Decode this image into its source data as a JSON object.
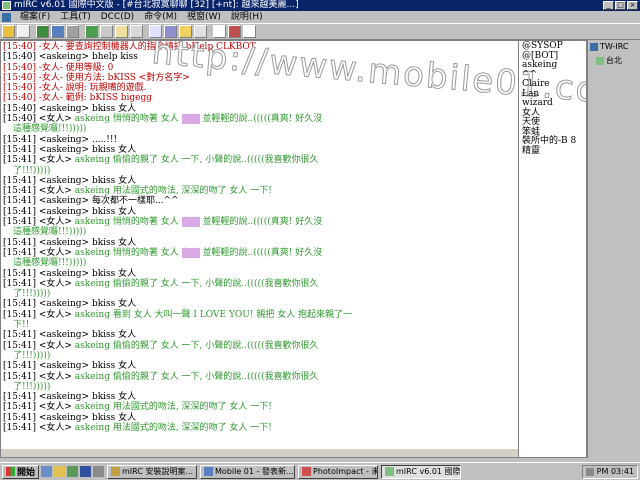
{
  "titlebar": {
    "title": "mIRC v6.01 國際中文版 - [#台北寂寞聊聊 [32] [+nt]: 越來越美麗...]"
  },
  "menubar": {
    "items": [
      "檔案(F)",
      "工具(T)",
      "DCC(D)",
      "命令(M)",
      "視窗(W)",
      "說明(H)"
    ]
  },
  "watermark": "http://www.mobile01.com",
  "chat": {
    "lines": [
      {
        "parts": [
          {
            "t": "[15:40] -女人- 要查詢控制機器人的指令請打 bHelp CLKBOT",
            "c": "red"
          }
        ]
      },
      {
        "parts": [
          {
            "t": "[15:40] <askeing> bhelp kiss"
          }
        ]
      },
      {
        "parts": [
          {
            "t": "[15:40] -女人- 使用等級: 0",
            "c": "red"
          }
        ]
      },
      {
        "parts": [
          {
            "t": "[15:40] -女人- 使用方法: bKISS <對方名字>",
            "c": "red"
          }
        ]
      },
      {
        "parts": [
          {
            "t": "[15:40] -女人- 說明: 玩親嘴的遊戲.",
            "c": "red"
          }
        ]
      },
      {
        "parts": [
          {
            "t": "[15:40] -女人- 範例: bKISS bigegg",
            "c": "red"
          }
        ]
      },
      {
        "parts": [
          {
            "t": "[15:40] <askeing> bkiss 女人"
          }
        ]
      },
      {
        "parts": [
          {
            "t": "[15:40] <女人> "
          },
          {
            "t": "askeing 悄悄的吻著 女人 ",
            "c": "green"
          },
          {
            "t": "女人",
            "c": "hl"
          },
          {
            "t": " 並輕輕的說..(((((真爽! 好久沒",
            "c": "green"
          }
        ]
      },
      {
        "indent": true,
        "parts": [
          {
            "t": "這種感覺囉!!!)))))",
            "c": "green"
          }
        ]
      },
      {
        "parts": [
          {
            "t": "[15:41] <askeing> .....!!!"
          }
        ]
      },
      {
        "parts": [
          {
            "t": "[15:41] <askeing> bkiss 女人"
          }
        ]
      },
      {
        "parts": [
          {
            "t": "[15:41] <女人> "
          },
          {
            "t": "askeing 偷偷的親了 女人 一下, 小聲的說..(((((我喜歡你很久",
            "c": "green"
          }
        ]
      },
      {
        "indent": true,
        "parts": [
          {
            "t": "了!!!)))))",
            "c": "green"
          }
        ]
      },
      {
        "parts": [
          {
            "t": "[15:41] <askeing> bkiss 女人"
          }
        ]
      },
      {
        "parts": [
          {
            "t": "[15:41] <女人> "
          },
          {
            "t": "askeing 用法國式的吻法, 深深的吻了 女人 一下!",
            "c": "green"
          }
        ]
      },
      {
        "parts": [
          {
            "t": "[15:41] <askeing> 每次都不一樣耶...^^"
          }
        ]
      },
      {
        "parts": [
          {
            "t": "[15:41] <askeing> bkiss 女人"
          }
        ]
      },
      {
        "parts": [
          {
            "t": "[15:41] <女人> "
          },
          {
            "t": "askeing 悄悄的吻著 女人 ",
            "c": "green"
          },
          {
            "t": "女人",
            "c": "hl"
          },
          {
            "t": " 並輕輕的說..(((((真爽! 好久沒",
            "c": "green"
          }
        ]
      },
      {
        "indent": true,
        "parts": [
          {
            "t": "這種感覺囉!!!)))))",
            "c": "green"
          }
        ]
      },
      {
        "parts": [
          {
            "t": "[15:41] <askeing> bkiss 女人"
          }
        ]
      },
      {
        "parts": [
          {
            "t": "[15:41] <女人> "
          },
          {
            "t": "askeing 悄悄的吻著 女人 ",
            "c": "green"
          },
          {
            "t": "女人",
            "c": "hl"
          },
          {
            "t": " 並輕輕的說..(((((真爽! 好久沒",
            "c": "green"
          }
        ]
      },
      {
        "indent": true,
        "parts": [
          {
            "t": "這種感覺囉!!!)))))",
            "c": "green"
          }
        ]
      },
      {
        "parts": [
          {
            "t": "[15:41] <askeing> bkiss 女人"
          }
        ]
      },
      {
        "parts": [
          {
            "t": "[15:41] <女人> "
          },
          {
            "t": "askeing 偷偷的親了 女人 一下, 小聲的說..(((((我喜歡你很久",
            "c": "green"
          }
        ]
      },
      {
        "indent": true,
        "parts": [
          {
            "t": "了!!!)))))",
            "c": "green"
          }
        ]
      },
      {
        "parts": [
          {
            "t": "[15:41] <askeing> bkiss 女人"
          }
        ]
      },
      {
        "parts": [
          {
            "t": "[15:41] <女人> "
          },
          {
            "t": "askeing 看到 女人 大叫一聲 I LOVE YOU! 親把 女人 抱起來親了一",
            "c": "green"
          }
        ]
      },
      {
        "indent": true,
        "parts": [
          {
            "t": "下!!",
            "c": "green"
          }
        ]
      },
      {
        "parts": [
          {
            "t": "[15:41] <askeing> bkiss 女人"
          }
        ]
      },
      {
        "parts": [
          {
            "t": "[15:41] <女人> "
          },
          {
            "t": "askeing 偷偷的親了 女人 一下, 小聲的說..(((((我喜歡你很久",
            "c": "green"
          }
        ]
      },
      {
        "indent": true,
        "parts": [
          {
            "t": "了!!!)))))",
            "c": "green"
          }
        ]
      },
      {
        "parts": [
          {
            "t": "[15:41] <askeing> bkiss 女人"
          }
        ]
      },
      {
        "parts": [
          {
            "t": "[15:41] <女人> "
          },
          {
            "t": "askeing 偷偷的親了 女人 一下, 小聲的說..(((((我喜歡你很久",
            "c": "green"
          }
        ]
      },
      {
        "indent": true,
        "parts": [
          {
            "t": "了!!!)))))",
            "c": "green"
          }
        ]
      },
      {
        "parts": [
          {
            "t": "[15:41] <askeing> bkiss 女人"
          }
        ]
      },
      {
        "parts": [
          {
            "t": "[15:41] <女人> "
          },
          {
            "t": "askeing 用法國式的吻法, 深深的吻了 女人 一下!",
            "c": "green"
          }
        ]
      },
      {
        "parts": [
          {
            "t": "[15:41] <askeing> bkiss 女人"
          }
        ]
      },
      {
        "parts": [
          {
            "t": "[15:41] <女人> "
          },
          {
            "t": "askeing 用法國式的吻法, 深深的吻了 女人 一下!",
            "c": "green"
          }
        ]
      }
    ]
  },
  "nicklist": [
    "@SYSOP",
    "@[BOT]",
    "askeing",
    "^^",
    "Claire",
    "Lan",
    "wizard",
    "女人",
    "天使",
    "笨蛙",
    "裝所中的-B 8",
    "精靈"
  ],
  "treebar": {
    "items": [
      "TW-IRC",
      "台北"
    ]
  },
  "taskbar": {
    "start_label": "開始",
    "tasks": [
      {
        "label": "mIRC 安裝說明案...",
        "active": false
      },
      {
        "label": "Mobile 01 - 發表新...",
        "active": false
      },
      {
        "label": "PhotoImpact - 未命...",
        "active": false
      },
      {
        "label": "mIRC v6.01 國際中...",
        "active": true
      }
    ],
    "clock": "PM 03:41"
  }
}
